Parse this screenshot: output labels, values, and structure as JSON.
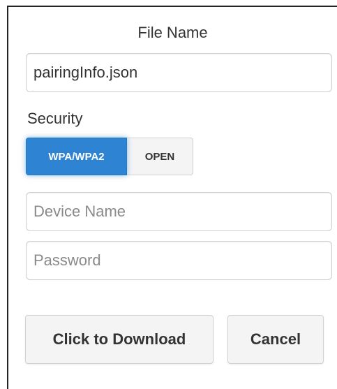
{
  "dialog": {
    "file_name_label": "File Name",
    "file_name_value": "pairingInfo.json",
    "security_label": "Security",
    "security_options": [
      {
        "label": "WPA/WPA2",
        "selected": true
      },
      {
        "label": "OPEN",
        "selected": false
      }
    ],
    "device_name_placeholder": "Device Name",
    "password_placeholder": "Password",
    "download_label": "Click to Download",
    "cancel_label": "Cancel"
  },
  "colors": {
    "accent": "#2e83d2",
    "frame_border": "#222222",
    "input_border": "#cfcfcf",
    "button_bg": "#f4f4f4"
  }
}
